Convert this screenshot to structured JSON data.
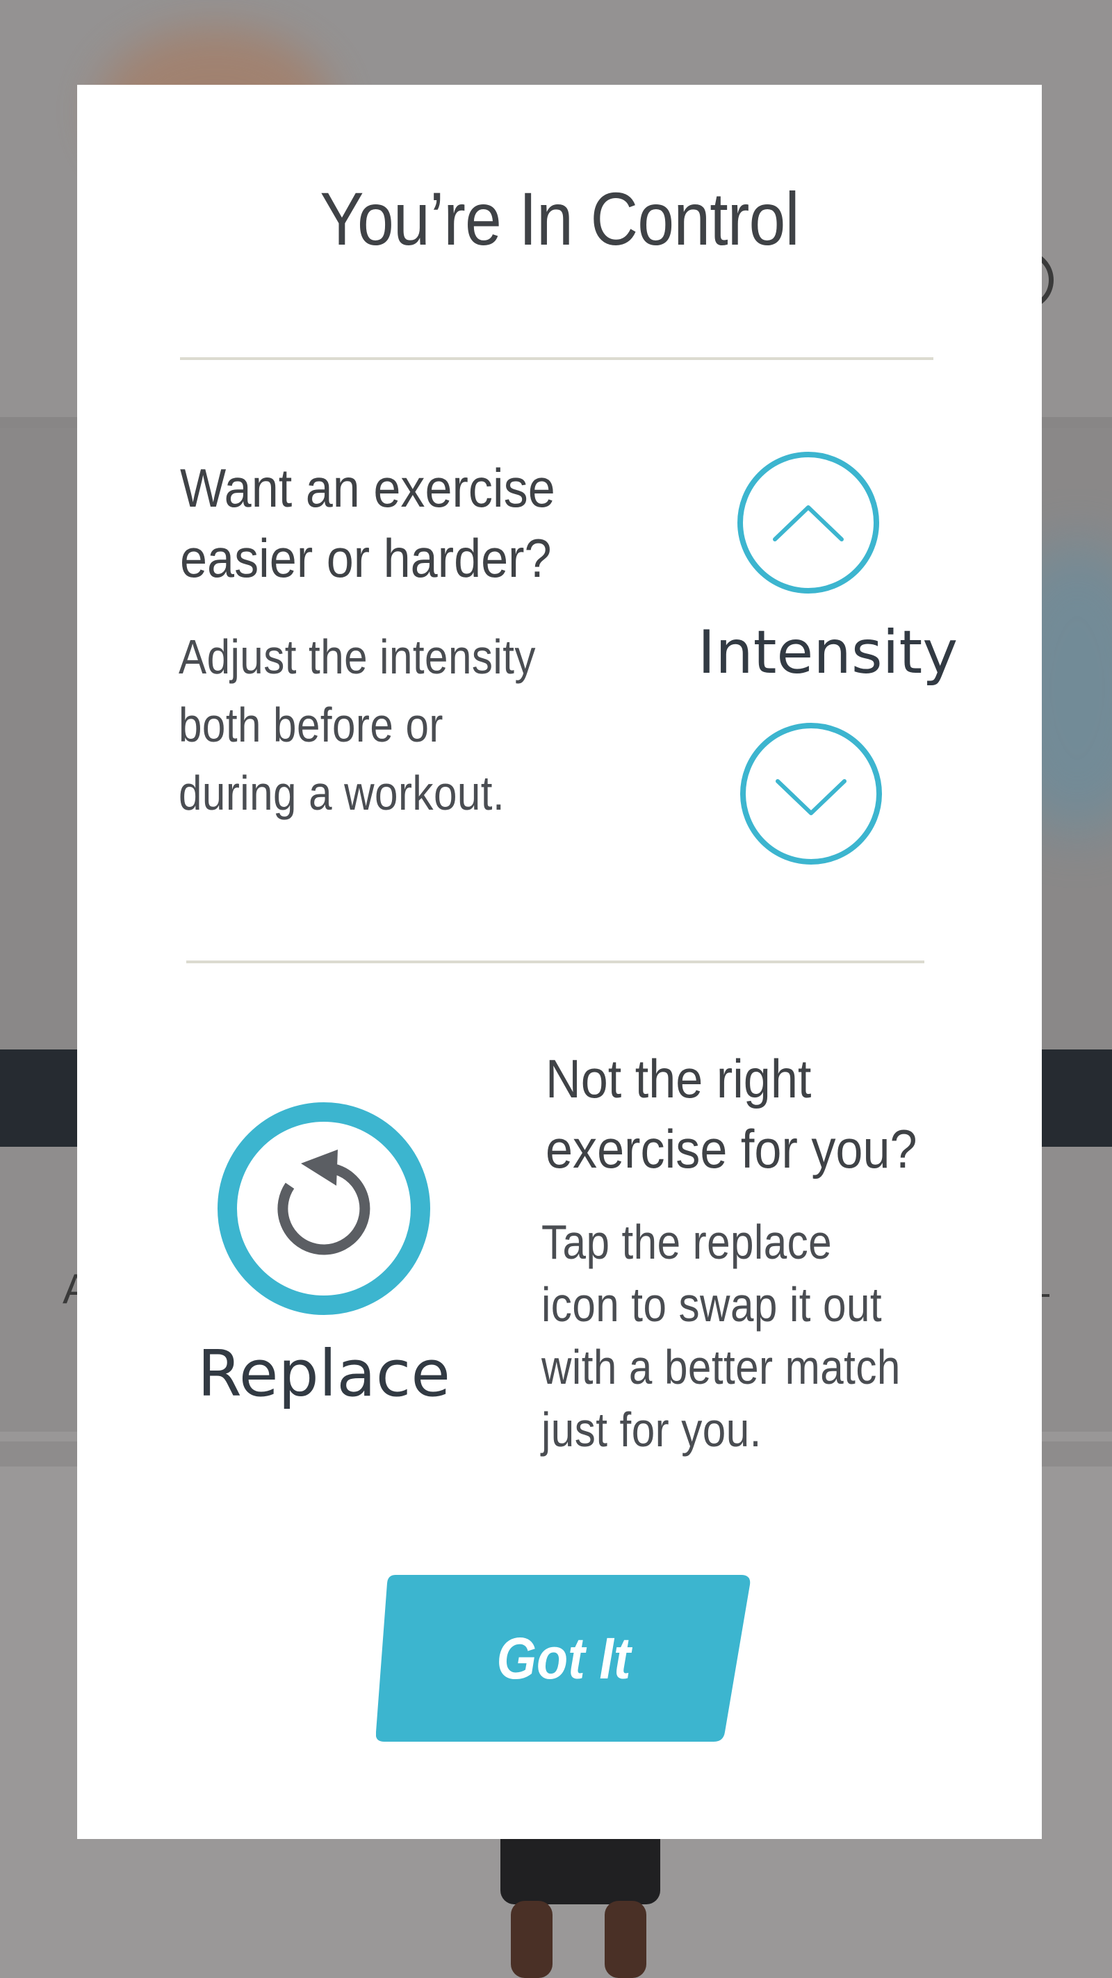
{
  "modal": {
    "title": "You’re In Control",
    "intensity": {
      "heading_line1": "Want an exercise",
      "heading_line2": "easier or harder?",
      "body_line1": "Adjust the intensity",
      "body_line2": "both before or",
      "body_line3": "during a workout.",
      "label": "Intensity",
      "up_icon": "chevron-up-icon",
      "down_icon": "chevron-down-icon"
    },
    "replace": {
      "heading_line1": "Not the right",
      "heading_line2": "exercise for you?",
      "body_line1": "Tap the replace",
      "body_line2": "icon to swap it out",
      "body_line3": "with a better match",
      "body_line4": "just for you.",
      "label": "Replace",
      "icon": "replace-icon"
    },
    "primary_button": {
      "label": "Got It"
    }
  },
  "colors": {
    "accent": "#3cb5cf",
    "text_dark": "#3f4246",
    "divider": "#dcdbd0",
    "overlay_bg": "#8e8c8c"
  }
}
